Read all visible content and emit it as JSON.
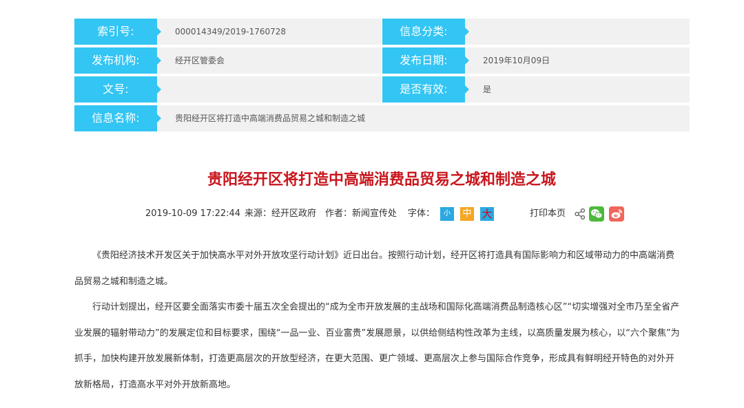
{
  "meta": {
    "index_label": "索引号:",
    "index_value": "000014349/2019-1760728",
    "category_label": "信息分类:",
    "category_value": "",
    "org_label": "发布机构:",
    "org_value": "经开区管委会",
    "date_label": "发布日期:",
    "date_value": "2019年10月09日",
    "docno_label": "文号:",
    "docno_value": "",
    "valid_label": "是否有效:",
    "valid_value": "是",
    "name_label": "信息名称:",
    "name_value": "贵阳经开区将打造中高端消费品贸易之城和制造之城"
  },
  "article": {
    "title": "贵阳经开区将打造中高端消费品贸易之城和制造之城",
    "datetime": "2019-10-09 17:22:44",
    "source": "来源：经开区政府",
    "author": "作者：新闻宣传处",
    "font_label": "字体：",
    "font_small": "小",
    "font_mid": "中",
    "font_big": "大",
    "print_label": "打印本页",
    "paragraphs": [
      "《贵阳经济技术开发区关于加快高水平对外开放攻坚行动计划》近日出台。按照行动计划，经开区将打造具有国际影响力和区域带动力的中高端消费品贸易之城和制造之城。",
      "行动计划提出，经开区要全面落实市委十届五次全会提出的“成为全市开放发展的主战场和国际化高端消费品制造核心区”“切实增强对全市乃至全省产业发展的辐射带动力”的发展定位和目标要求，围绕“一品一业、百业富贵”发展愿景，以供给侧结构性改革为主线，以高质量发展为核心，以“六个聚焦”为抓手，加快构建开放发展新体制，打造更高层次的开放型经济，在更大范围、更广领域、更高层次上参与国际合作竞争，形成具有鲜明经开特色的对外开放新格局，打造高水平对外开放新高地。"
    ]
  },
  "icons": {
    "share": "share-icon",
    "wechat": "wechat-icon",
    "weibo": "weibo-icon"
  },
  "colors": {
    "label_bg": "#33c5f3",
    "title_red": "#c8161d"
  }
}
